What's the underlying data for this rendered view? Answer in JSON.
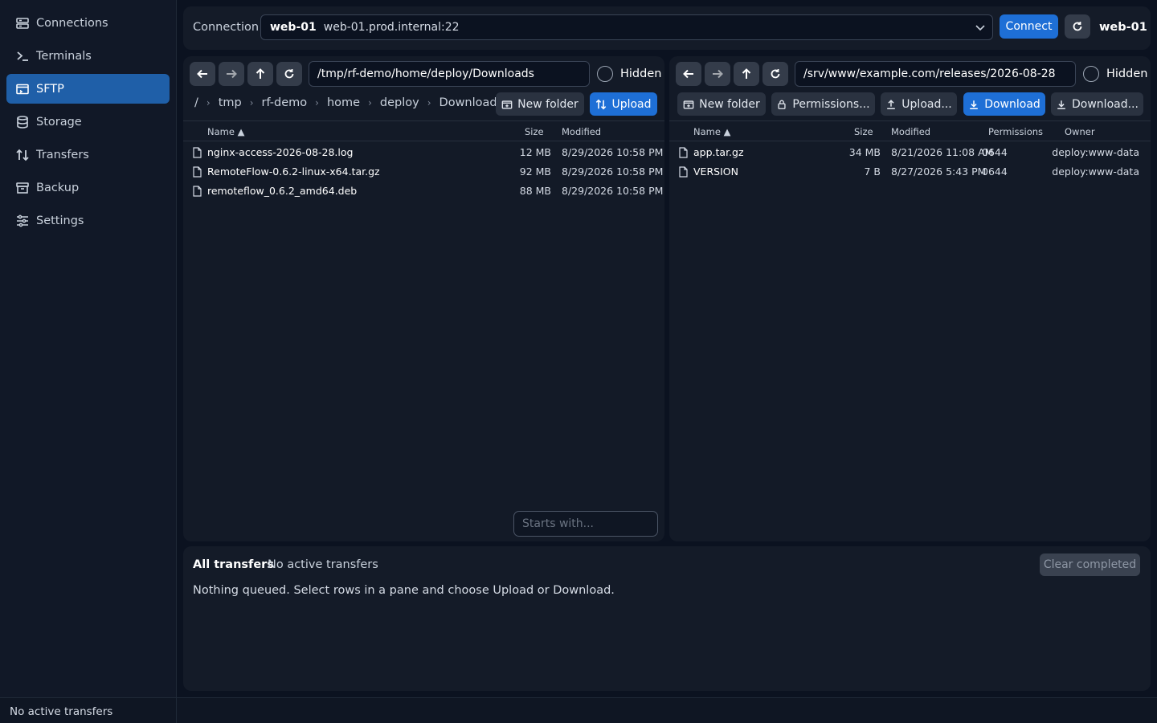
{
  "sidebar": {
    "items": [
      {
        "label": "Connections",
        "icon": "server-icon"
      },
      {
        "label": "Terminals",
        "icon": "terminal-icon"
      },
      {
        "label": "SFTP",
        "icon": "sftp-folder-icon",
        "active": true
      },
      {
        "label": "Storage",
        "icon": "database-icon"
      },
      {
        "label": "Transfers",
        "icon": "transfer-arrows-icon"
      },
      {
        "label": "Backup",
        "icon": "archive-icon"
      },
      {
        "label": "Settings",
        "icon": "sliders-icon"
      }
    ]
  },
  "statusbar": {
    "text": "No active transfers"
  },
  "connection": {
    "label": "Connection",
    "selected_name": "web-01",
    "selected_host": "web-01.prod.internal:22",
    "connect_label": "Connect",
    "active_name": "web-01"
  },
  "local": {
    "path": "/tmp/rf-demo/home/deploy/Downloads",
    "hidden_label": "Hidden",
    "breadcrumb": [
      "/",
      "tmp",
      "rf-demo",
      "home",
      "deploy",
      "Downloads"
    ],
    "new_folder_label": "New folder",
    "upload_label": "Upload",
    "columns": {
      "name": "Name ▲",
      "size": "Size",
      "modified": "Modified"
    },
    "files": [
      {
        "name": "nginx-access-2026-08-28.log",
        "size": "12 MB",
        "modified": "8/29/2026 10:58 PM"
      },
      {
        "name": "RemoteFlow-0.6.2-linux-x64.tar.gz",
        "size": "92 MB",
        "modified": "8/29/2026 10:58 PM"
      },
      {
        "name": "remoteflow_0.6.2_amd64.deb",
        "size": "88 MB",
        "modified": "8/29/2026 10:58 PM"
      }
    ],
    "filter_placeholder": "Starts with..."
  },
  "remote": {
    "path": "/srv/www/example.com/releases/2026-08-28",
    "hidden_label": "Hidden",
    "new_folder_label": "New folder",
    "permissions_label": "Permissions...",
    "upload_label": "Upload...",
    "download_label": "Download",
    "download_as_label": "Download...",
    "columns": {
      "name": "Name ▲",
      "size": "Size",
      "modified": "Modified",
      "permissions": "Permissions",
      "owner": "Owner"
    },
    "files": [
      {
        "name": "app.tar.gz",
        "size": "34 MB",
        "modified": "8/21/2026 11:08 AM",
        "permissions": "0644",
        "owner": "deploy:www-data"
      },
      {
        "name": "VERSION",
        "size": "7 B",
        "modified": "8/27/2026 5:43 PM",
        "permissions": "0644",
        "owner": "deploy:www-data"
      }
    ]
  },
  "transfers": {
    "title": "All transfers",
    "status": "No active transfers",
    "message": "Nothing queued. Select rows in a pane and choose Upload or Download.",
    "clear_label": "Clear completed"
  },
  "colors": {
    "accent": "#1e6fd6",
    "sidebar_active": "#1f5fa8",
    "background": "#0b1220",
    "panel": "#131a27"
  }
}
